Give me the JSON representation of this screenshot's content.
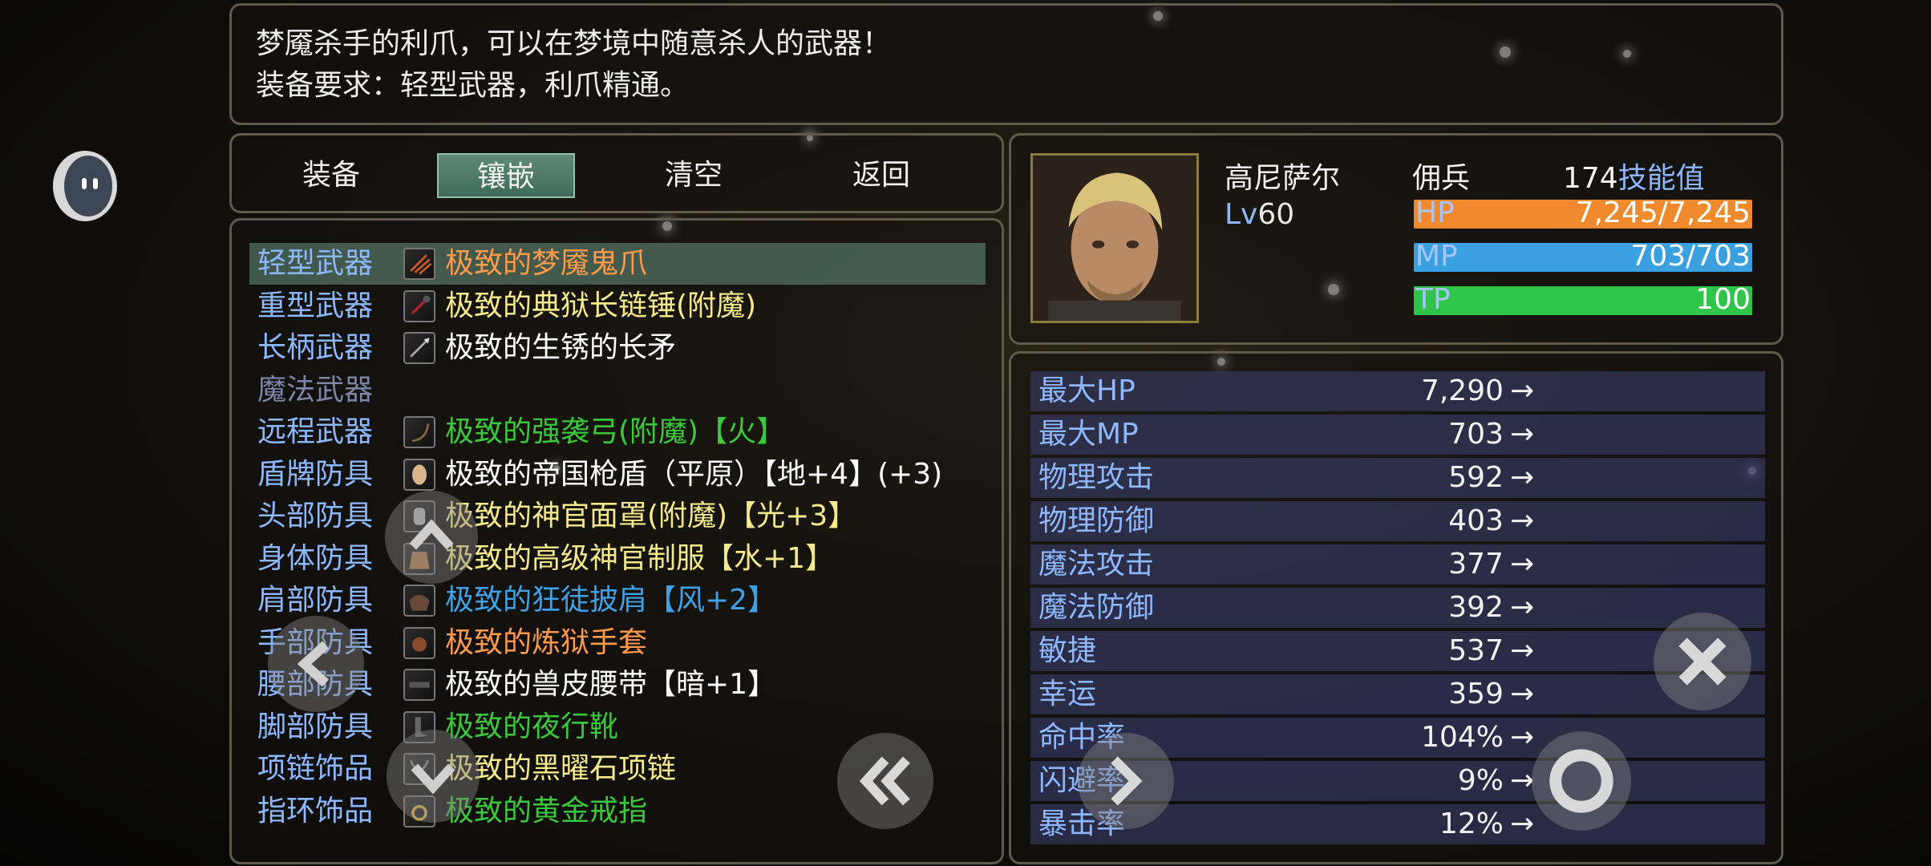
{
  "description": {
    "line1": "梦魇杀手的利爪，可以在梦境中随意杀人的武器！",
    "line2": "装备要求：轻型武器，利爪精通。"
  },
  "tabs": [
    {
      "label": "装备",
      "active": false
    },
    {
      "label": "镶嵌",
      "active": true
    },
    {
      "label": "清空",
      "active": false
    },
    {
      "label": "返回",
      "active": false
    }
  ],
  "equipment": [
    {
      "slot": "轻型武器",
      "item": "极致的梦魇鬼爪",
      "color": "#ff9a4a",
      "selected": true,
      "icon": "claw-icon"
    },
    {
      "slot": "重型武器",
      "item": "极致的典狱长链锤(附魔)",
      "color": "#f4ea8c",
      "icon": "chain-hammer-icon"
    },
    {
      "slot": "长柄武器",
      "item": "极致的生锈的长矛",
      "color": "#ffffff",
      "icon": "spear-icon"
    },
    {
      "slot": "魔法武器",
      "item": "",
      "color": "#ffffff",
      "dim": true,
      "icon": ""
    },
    {
      "slot": "远程武器",
      "item": "极致的强袭弓(附魔)【火】",
      "color": "#3cc83c",
      "icon": "bow-icon"
    },
    {
      "slot": "盾牌防具",
      "item": "极致的帝国枪盾（平原）【地+4】(+3)",
      "color": "#ffffff",
      "icon": "shield-icon"
    },
    {
      "slot": "头部防具",
      "item": "极致的神官面罩(附魔)【光+3】",
      "color": "#f4ea8c",
      "icon": "mask-icon"
    },
    {
      "slot": "身体防具",
      "item": "极致的高级神官制服【水+1】",
      "color": "#f4ea8c",
      "icon": "robe-icon"
    },
    {
      "slot": "肩部防具",
      "item": "极致的狂徒披肩【风+2】",
      "color": "#3fa2e8",
      "icon": "shawl-icon"
    },
    {
      "slot": "手部防具",
      "item": "极致的炼狱手套",
      "color": "#ff9a4a",
      "icon": "gloves-icon"
    },
    {
      "slot": "腰部防具",
      "item": "极致的兽皮腰带【暗+1】",
      "color": "#ffffff",
      "icon": "belt-icon"
    },
    {
      "slot": "脚部防具",
      "item": "极致的夜行靴",
      "color": "#3cc83c",
      "icon": "boots-icon"
    },
    {
      "slot": "项链饰品",
      "item": "极致的黑曜石项链",
      "color": "#f4ea8c",
      "icon": "necklace-icon"
    },
    {
      "slot": "指环饰品",
      "item": "极致的黄金戒指",
      "color": "#3cc83c",
      "icon": "ring-icon"
    }
  ],
  "character": {
    "name": "高尼萨尔",
    "level_label": "Lv",
    "level": "60",
    "class": "佣兵",
    "skill_points": "174",
    "skill_points_label": "技能值",
    "hp": {
      "label": "HP",
      "text": "7,245/7,245",
      "fraction": 1.0,
      "color": "#f08a2c"
    },
    "mp": {
      "label": "MP",
      "text": "703/703",
      "fraction": 1.0,
      "color": "#3aa0e0"
    },
    "tp": {
      "label": "TP",
      "text": "100",
      "fraction": 1.0,
      "color": "#2ec54a"
    }
  },
  "stats": [
    {
      "name": "最大HP",
      "value": "7,290"
    },
    {
      "name": "最大MP",
      "value": "703"
    },
    {
      "name": "物理攻击",
      "value": "592"
    },
    {
      "name": "物理防御",
      "value": "403"
    },
    {
      "name": "魔法攻击",
      "value": "377"
    },
    {
      "name": "魔法防御",
      "value": "392"
    },
    {
      "name": "敏捷",
      "value": "537"
    },
    {
      "name": "幸运",
      "value": "359"
    },
    {
      "name": "命中率",
      "value": "104%"
    },
    {
      "name": "闪避率",
      "value": "9%"
    },
    {
      "name": "暴击率",
      "value": "12%"
    }
  ],
  "arrow": "→",
  "overlay_controls": [
    "dpad-up",
    "dpad-left",
    "dpad-down",
    "prev-page-button",
    "next-page-button",
    "close-button",
    "confirm-button"
  ]
}
